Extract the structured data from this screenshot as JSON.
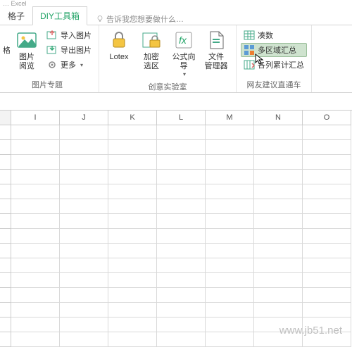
{
  "top_truncated": "… Excel",
  "tabs": {
    "left_partial": "格子",
    "active": "DIY工具箱"
  },
  "tell_me": "告诉我您想要做什么…",
  "ribbon": {
    "group1": {
      "label": "图片专题",
      "left_partial_top": "",
      "left_partial_bottom": "格",
      "big1": "图片\n阅览",
      "small1": "导入图片",
      "small2": "导出图片",
      "small3": "更多"
    },
    "group2": {
      "label": "创意实验室",
      "big1": "Lotex",
      "big2": "加密\n选区",
      "big3": "公式向\n导",
      "big4": "文件\n管理器"
    },
    "group3": {
      "label": "网友建议直通车",
      "small1": "凑数",
      "small2": "多区域汇总",
      "small3": "各列累计汇总"
    }
  },
  "columns": [
    "I",
    "J",
    "K",
    "L",
    "M",
    "N",
    "O"
  ],
  "watermark": "www.jb51.net"
}
